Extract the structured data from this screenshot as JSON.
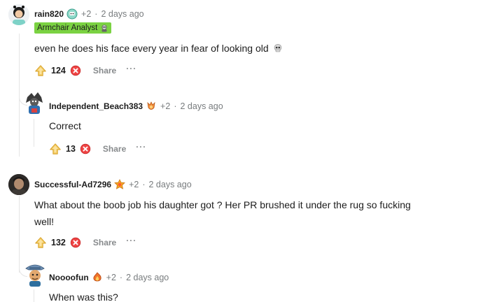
{
  "comments": [
    {
      "username": "rain820",
      "karma": "+2",
      "separator": "·",
      "time": "2 days ago",
      "flair": "Armchair Analyst",
      "text": "even he does his face every year in fear of looking old",
      "votes": "124",
      "share_label": "Share",
      "more_label": "···"
    },
    {
      "username": "Independent_Beach383",
      "karma": "+2",
      "separator": "·",
      "time": "2 days ago",
      "text": "Correct",
      "votes": "13",
      "share_label": "Share",
      "more_label": "···"
    },
    {
      "username": "Successful-Ad7296",
      "karma": "+2",
      "separator": "·",
      "time": "2 days ago",
      "text_line1": "What about the boob job his daughter got ? Her PR brushed it under the rug so fucking",
      "text_line2": "well!",
      "votes": "132",
      "share_label": "Share",
      "more_label": "···"
    },
    {
      "username": "Noooofun",
      "karma": "+2",
      "separator": "·",
      "time": "2 days ago",
      "text": "When was this?"
    }
  ],
  "icons": {
    "upvote": "upvote-icon",
    "downvote": "downvote-icon",
    "skull": "skull-emoji",
    "achievement": "achievement-badge-icon"
  },
  "colors": {
    "flair_bg": "#7bd242",
    "upvote": "#f2c14e",
    "downvote": "#ef4444",
    "meta_text": "#787c7e",
    "thread_line": "#e5e5e5"
  }
}
